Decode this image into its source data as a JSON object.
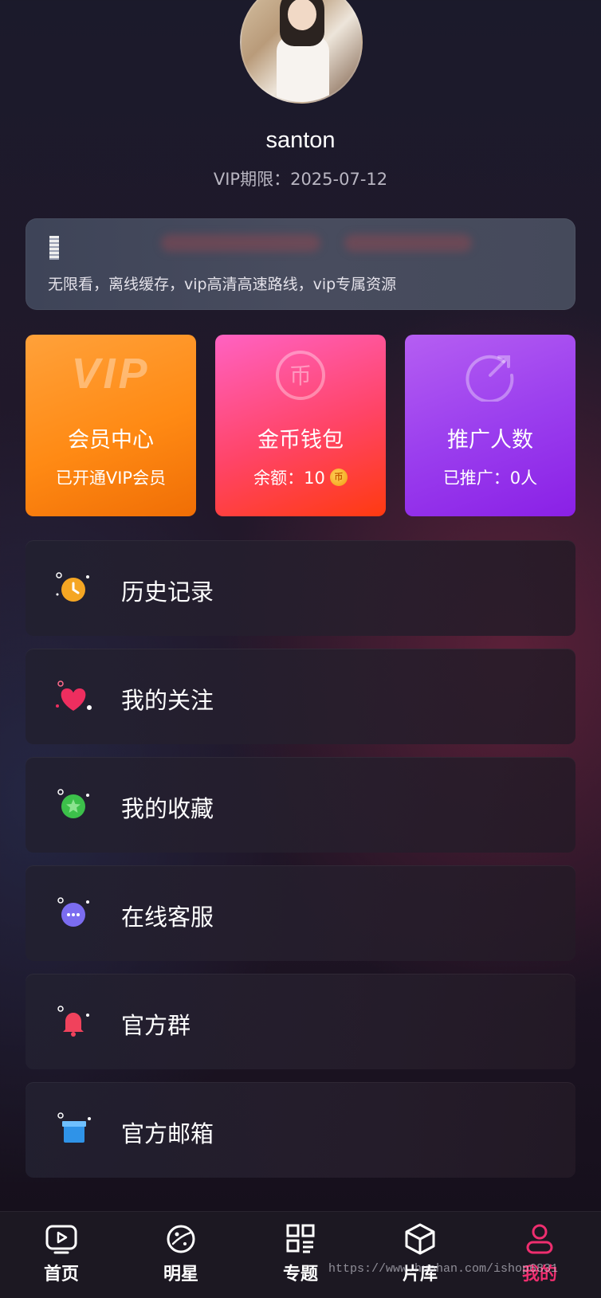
{
  "profile": {
    "username": "santon",
    "vip_expire": "VIP期限：2025-07-12"
  },
  "vip_banner": {
    "icon": "ruler-icon",
    "description": "无限看，离线缓存，vip高清高速路线，vip专属资源"
  },
  "cards": [
    {
      "id": "vip",
      "badge": "VIP",
      "title": "会员中心",
      "subtitle": "已开通VIP会员",
      "colors": [
        "#ffa13a",
        "#f06e05"
      ]
    },
    {
      "id": "coin",
      "icon": "coin-icon",
      "title": "金币钱包",
      "subtitle": "余额：10",
      "colors": [
        "#ff62c2",
        "#ff3a10"
      ]
    },
    {
      "id": "promo",
      "icon": "share-arrow-icon",
      "title": "推广人数",
      "subtitle": "已推广：0人",
      "colors": [
        "#b55ef2",
        "#8a20e6"
      ]
    }
  ],
  "menu": [
    {
      "label": "历史记录",
      "icon": "clock-icon"
    },
    {
      "label": "我的关注",
      "icon": "heart-icon"
    },
    {
      "label": "我的收藏",
      "icon": "star-icon"
    },
    {
      "label": "在线客服",
      "icon": "chat-icon"
    },
    {
      "label": "官方群",
      "icon": "bell-icon"
    },
    {
      "label": "官方邮箱",
      "icon": "mailbox-icon"
    }
  ],
  "tabs": [
    {
      "label": "首页",
      "icon": "tv-icon",
      "active": false
    },
    {
      "label": "明星",
      "icon": "planet-icon",
      "active": false
    },
    {
      "label": "专题",
      "icon": "grid-icon",
      "active": false
    },
    {
      "label": "片库",
      "icon": "cube-icon",
      "active": false
    },
    {
      "label": "我的",
      "icon": "user-icon",
      "active": true
    }
  ],
  "accent_color": "#ee2e6f",
  "watermark": "https://www.huohan.com/ishop6831"
}
